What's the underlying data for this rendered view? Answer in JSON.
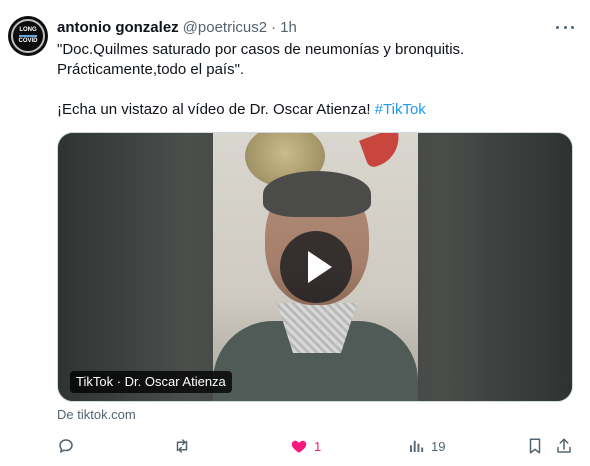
{
  "author": {
    "name": "antonio gonzalez",
    "handle": "@poetricus2",
    "separator": "·",
    "time": "1h",
    "avatar_text_top": "LONG",
    "avatar_text_bottom": "COVID"
  },
  "tweet": {
    "line1": "\"Doc.Quilmes saturado por casos de neumonías y bronquitis.",
    "line2": "Prácticamente,todo el país\".",
    "line3_text": "¡Echa un vistazo al vídeo de Dr. Oscar Atienza! ",
    "line3_hashtag": "#TikTok"
  },
  "media": {
    "label": "TikTok · Dr. Oscar Atienza",
    "source": "De tiktok.com"
  },
  "actions": {
    "reply_count": "",
    "repost_count": "",
    "like_count": "1",
    "views_count": "19"
  },
  "colors": {
    "accent": "#1d9bf0",
    "like": "#f91880",
    "muted": "#536471"
  },
  "icons": [
    "more-icon",
    "reply-icon",
    "repost-icon",
    "heart-icon",
    "views-icon",
    "bookmark-icon",
    "share-icon",
    "play-icon"
  ]
}
